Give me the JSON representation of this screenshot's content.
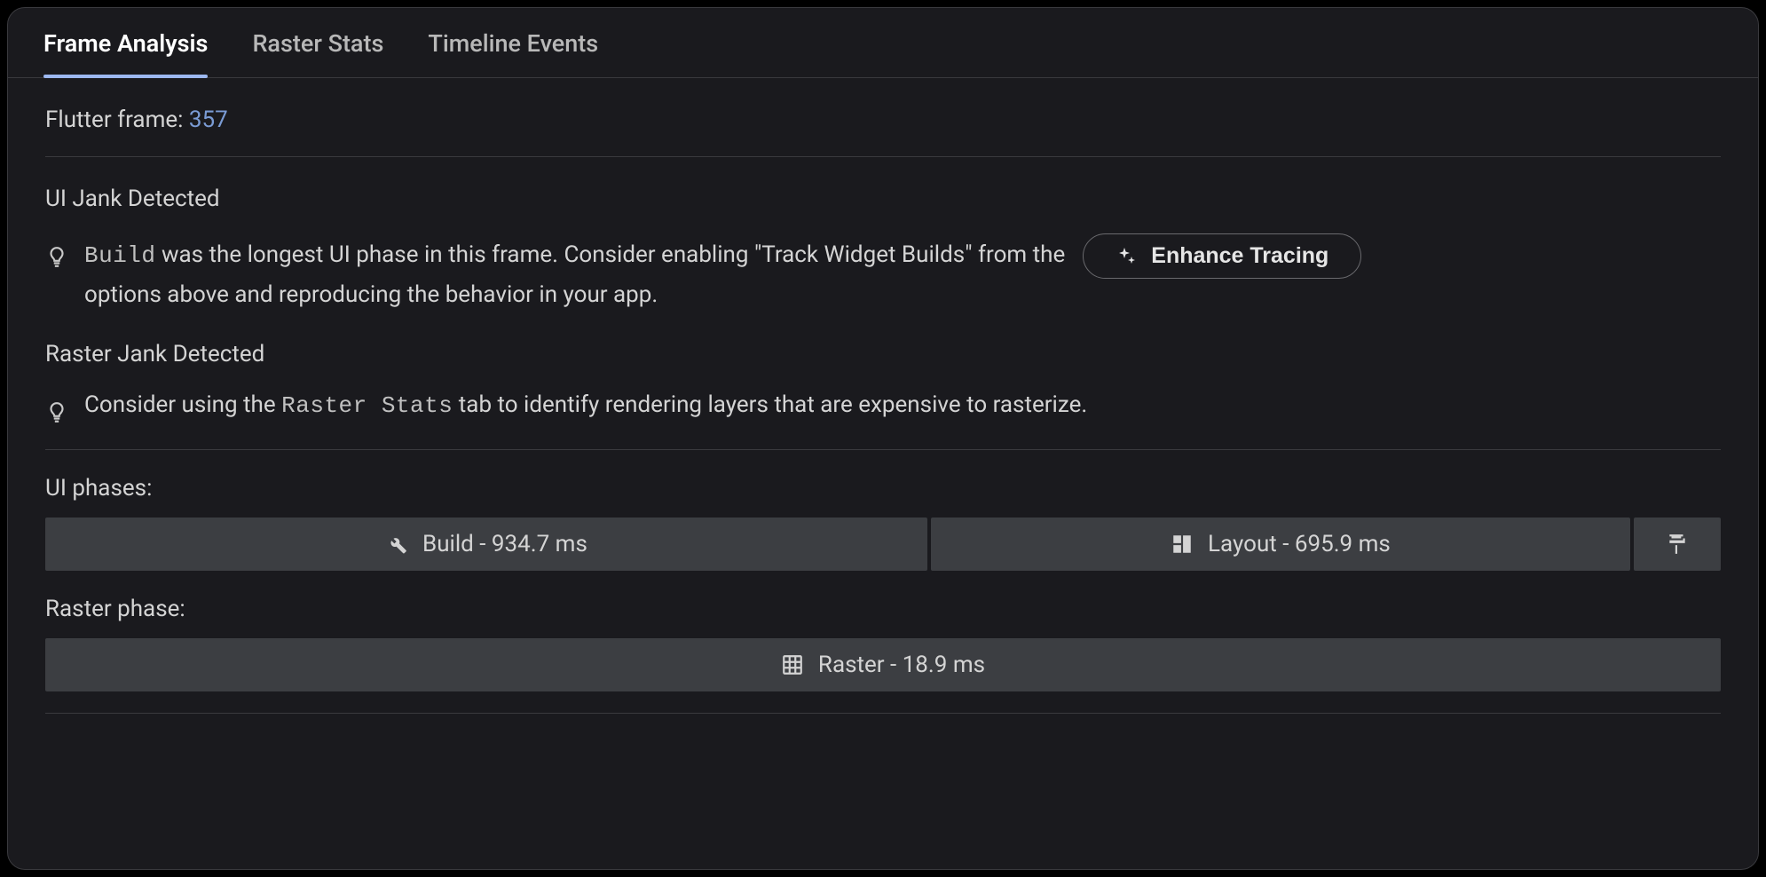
{
  "tabs": [
    {
      "label": "Frame Analysis",
      "active": true
    },
    {
      "label": "Raster Stats",
      "active": false
    },
    {
      "label": "Timeline Events",
      "active": false
    }
  ],
  "frame": {
    "prefix": "Flutter frame: ",
    "number": "357"
  },
  "ui_jank": {
    "title": "UI Jank Detected",
    "tip_code": "Build",
    "tip_part1": " was the longest UI phase in this frame. Consider enabling \"Track Widget Builds\" from the",
    "enhance_button": "Enhance Tracing",
    "tip_part2": "options above and reproducing the behavior in your app."
  },
  "raster_jank": {
    "title": "Raster Jank Detected",
    "tip_part1": "Consider using the ",
    "tip_code": "Raster Stats",
    "tip_part2": " tab to identify rendering layers that are expensive to rasterize."
  },
  "ui_phases": {
    "label": "UI phases:",
    "segments": [
      {
        "label": "Build - 934.7 ms",
        "icon": "wrench",
        "flex": 792
      },
      {
        "label": "Layout - 695.9 ms",
        "icon": "layout",
        "flex": 628
      },
      {
        "label": "",
        "icon": "paint-roller",
        "flex": 0
      }
    ]
  },
  "raster_phase": {
    "label": "Raster phase:",
    "segments": [
      {
        "label": "Raster - 18.9 ms",
        "icon": "grid",
        "flex": 1
      }
    ]
  }
}
